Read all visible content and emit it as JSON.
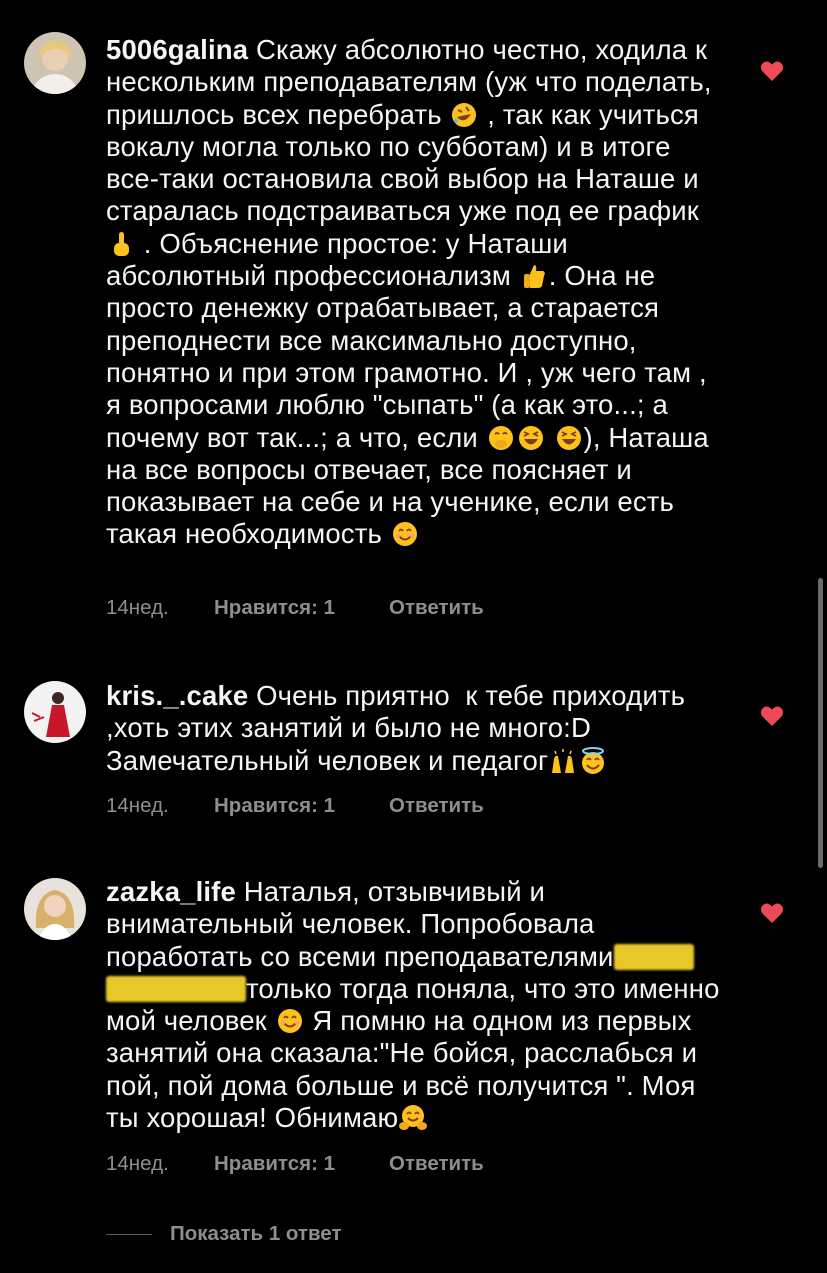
{
  "comments": [
    {
      "username": "5006galina",
      "segments": [
        "Скажу абсолютно честно, ходила к нескольким преподавателям (уж что поделать, пришлось всех перебрать ",
        " , так как учиться вокалу могла только по субботам) и в итоге все-таки остановила свой выбор на Наташе и старалась подстраиваться уже под ее график ",
        " . Объяснение простое: у Наташи абсолютный профессионализм ",
        ". Она не просто денежку отрабатывает, а старается преподнести все максимально доступно, понятно и при этом грамотно. И , уж чего там , я вопросами люблю \"сыпать\" (а как это...; а почему вот так...; а что, если ",
        "), Наташа на все вопросы отвечает, все поясняет и показывает на себе и на ученике, если есть такая необходимость "
      ],
      "emojis": [
        "rofl-emoji",
        "pointing-up-emoji",
        "thumbs-up-emoji",
        "hand-over-mouth-emoji",
        "grinning-squinting-emoji",
        "grinning-squinting-emoji",
        "smiling-eyes-emoji"
      ],
      "time": "14нед.",
      "likes": "Нравится: 1",
      "reply": "Ответить",
      "liked": true
    },
    {
      "username": "kris._.cake",
      "segments": [
        "Очень приятно  к тебе приходить ,хоть этих занятий и было не много:D Замечательный человек и педагог"
      ],
      "emojis": [
        "raising-hands-emoji",
        "halo-emoji"
      ],
      "time": "14нед.",
      "likes": "Нравится: 1",
      "reply": "Ответить",
      "liked": true
    },
    {
      "username": "zazka_life",
      "segments": [
        "Наталья, отзывчивый и внимательный человек. Попробовала поработать со всеми преподавателями",
        "только тогда поняла, что это именно мой человек ",
        " Я помню на одном из первых занятий она сказала:\"Не бойся, расслабься и пой, пой дома больше и всё получится \". Моя ты хорошая! Обнимаю"
      ],
      "emojis": [
        "smiling-eyes-emoji",
        "hugging-emoji"
      ],
      "time": "14нед.",
      "likes": "Нравится: 1",
      "reply": "Ответить",
      "liked": true
    }
  ],
  "show_replies": "Показать 1 ответ",
  "colors": {
    "background": "#000000",
    "text": "#f5f5f5",
    "meta": "#8e8e8e",
    "heart": "#ed4956",
    "redaction": "#f5d22b"
  }
}
